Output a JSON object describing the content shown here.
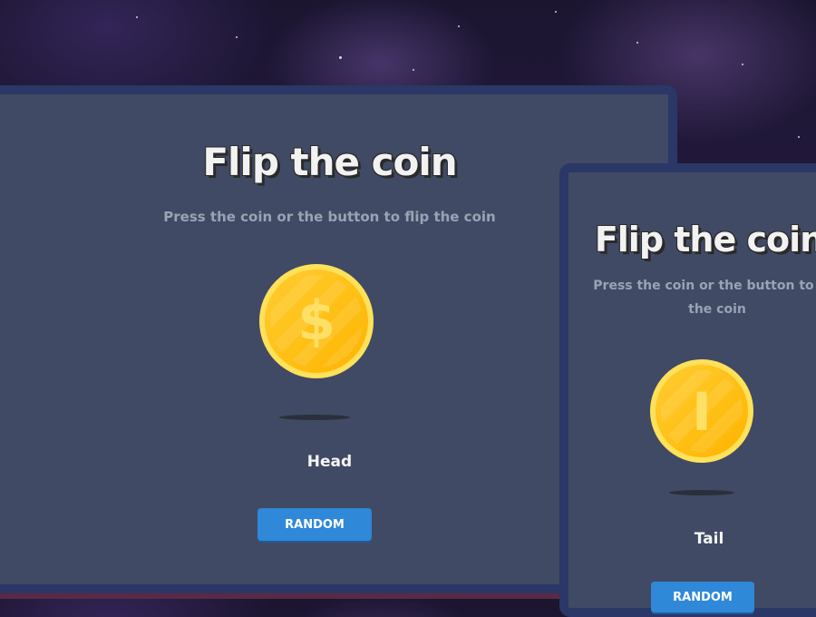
{
  "panels": [
    {
      "title": "Flip the coin",
      "subtitle": "Press the coin or the button to flip the coin",
      "coin_face": "$",
      "result": "Head",
      "button_label": "RANDOM"
    },
    {
      "title": "Flip the coin",
      "subtitle": "Press the coin or the button to flip the coin",
      "coin_face": "I",
      "result": "Tail",
      "button_label": "RANDOM"
    }
  ],
  "colors": {
    "panel_bg": "#404a64",
    "panel_border": "#2b3766",
    "coin_gold": "#ffc21a",
    "coin_rim": "#ffe15a",
    "button_blue": "#2f88d8"
  }
}
